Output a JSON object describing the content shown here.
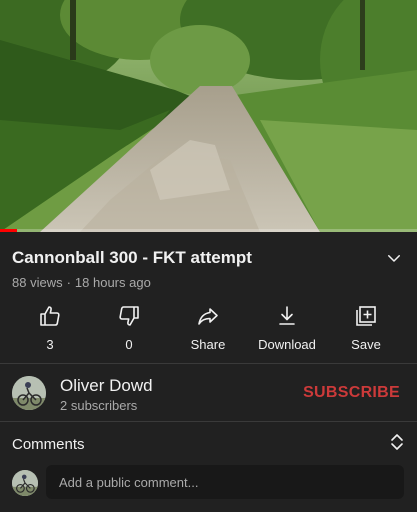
{
  "player": {
    "progress_percent": 4
  },
  "video": {
    "title": "Cannonball 300 - FKT attempt",
    "views": "88 views",
    "age": "18 hours ago"
  },
  "actions": {
    "like_count": "3",
    "dislike_count": "0",
    "share_label": "Share",
    "download_label": "Download",
    "save_label": "Save"
  },
  "channel": {
    "name": "Oliver Dowd",
    "subscribers": "2 subscribers",
    "subscribe_label": "SUBSCRIBE"
  },
  "comments": {
    "title": "Comments",
    "placeholder": "Add a public comment..."
  },
  "icons": {
    "expand": "chevron-down-icon",
    "like": "thumbs-up-icon",
    "dislike": "thumbs-down-icon",
    "share": "share-icon",
    "download": "download-icon",
    "save": "playlist-add-icon",
    "comments_toggle": "unfold-icon"
  },
  "colors": {
    "background": "#212121",
    "subscribe": "#cc3a3a",
    "progress": "#ff0000",
    "secondary_text": "#aaaaaa"
  }
}
